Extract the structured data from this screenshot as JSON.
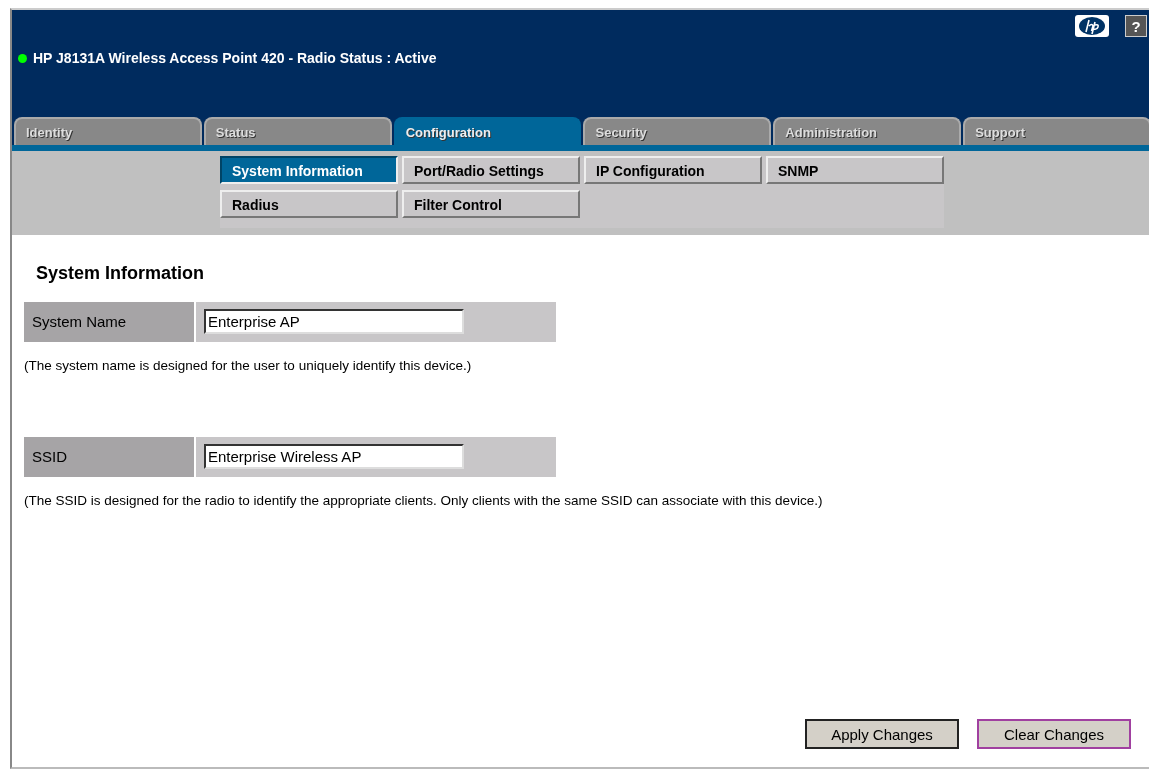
{
  "header": {
    "title": "HP J8131A Wireless Access Point 420 - Radio Status :  Active",
    "radio_on": true,
    "help": "?"
  },
  "tabs": [
    {
      "label": "Identity",
      "selected": false
    },
    {
      "label": "Status",
      "selected": false
    },
    {
      "label": "Configuration",
      "selected": true
    },
    {
      "label": "Security",
      "selected": false
    },
    {
      "label": "Administration",
      "selected": false
    },
    {
      "label": "Support",
      "selected": false
    }
  ],
  "subnav": [
    {
      "label": "System Information",
      "selected": true
    },
    {
      "label": "Port/Radio Settings",
      "selected": false
    },
    {
      "label": "IP Configuration",
      "selected": false
    },
    {
      "label": "SNMP",
      "selected": false
    },
    {
      "label": "Radius",
      "selected": false
    },
    {
      "label": "Filter Control",
      "selected": false
    }
  ],
  "page_title": "System Information",
  "fields": [
    {
      "label": "System Name",
      "value": "Enterprise AP",
      "note": "(The system name is designed for the user to uniquely identify this device.)"
    },
    {
      "label": "SSID",
      "value": "Enterprise Wireless AP",
      "note": "(The SSID is designed for the radio to identify the appropriate clients. Only clients with the same SSID can associate with this device.)"
    }
  ],
  "buttons": [
    {
      "label": "Apply Changes",
      "focused": false
    },
    {
      "label": "Clear Changes",
      "focused": true
    }
  ]
}
